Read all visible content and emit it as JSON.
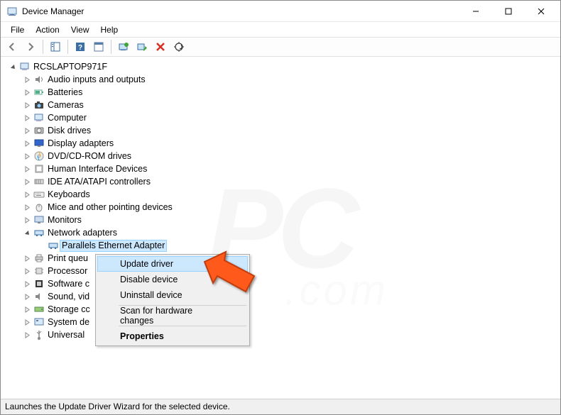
{
  "window": {
    "title": "Device Manager"
  },
  "menu": {
    "file": "File",
    "action": "Action",
    "view": "View",
    "help": "Help"
  },
  "tree": {
    "root": "RCSLAPTOP971F",
    "items": [
      "Audio inputs and outputs",
      "Batteries",
      "Cameras",
      "Computer",
      "Disk drives",
      "Display adapters",
      "DVD/CD-ROM drives",
      "Human Interface Devices",
      "IDE ATA/ATAPI controllers",
      "Keyboards",
      "Mice and other pointing devices",
      "Monitors",
      "Network adapters",
      "Print queu",
      "Processor",
      "Software c",
      "Sound, vid",
      "Storage cc",
      "System de",
      "Universal"
    ],
    "selected_child": "Parallels Ethernet Adapter"
  },
  "context_menu": {
    "update": "Update driver",
    "disable": "Disable device",
    "uninstall": "Uninstall device",
    "scan": "Scan for hardware changes",
    "properties": "Properties"
  },
  "status": "Launches the Update Driver Wizard for the selected device."
}
